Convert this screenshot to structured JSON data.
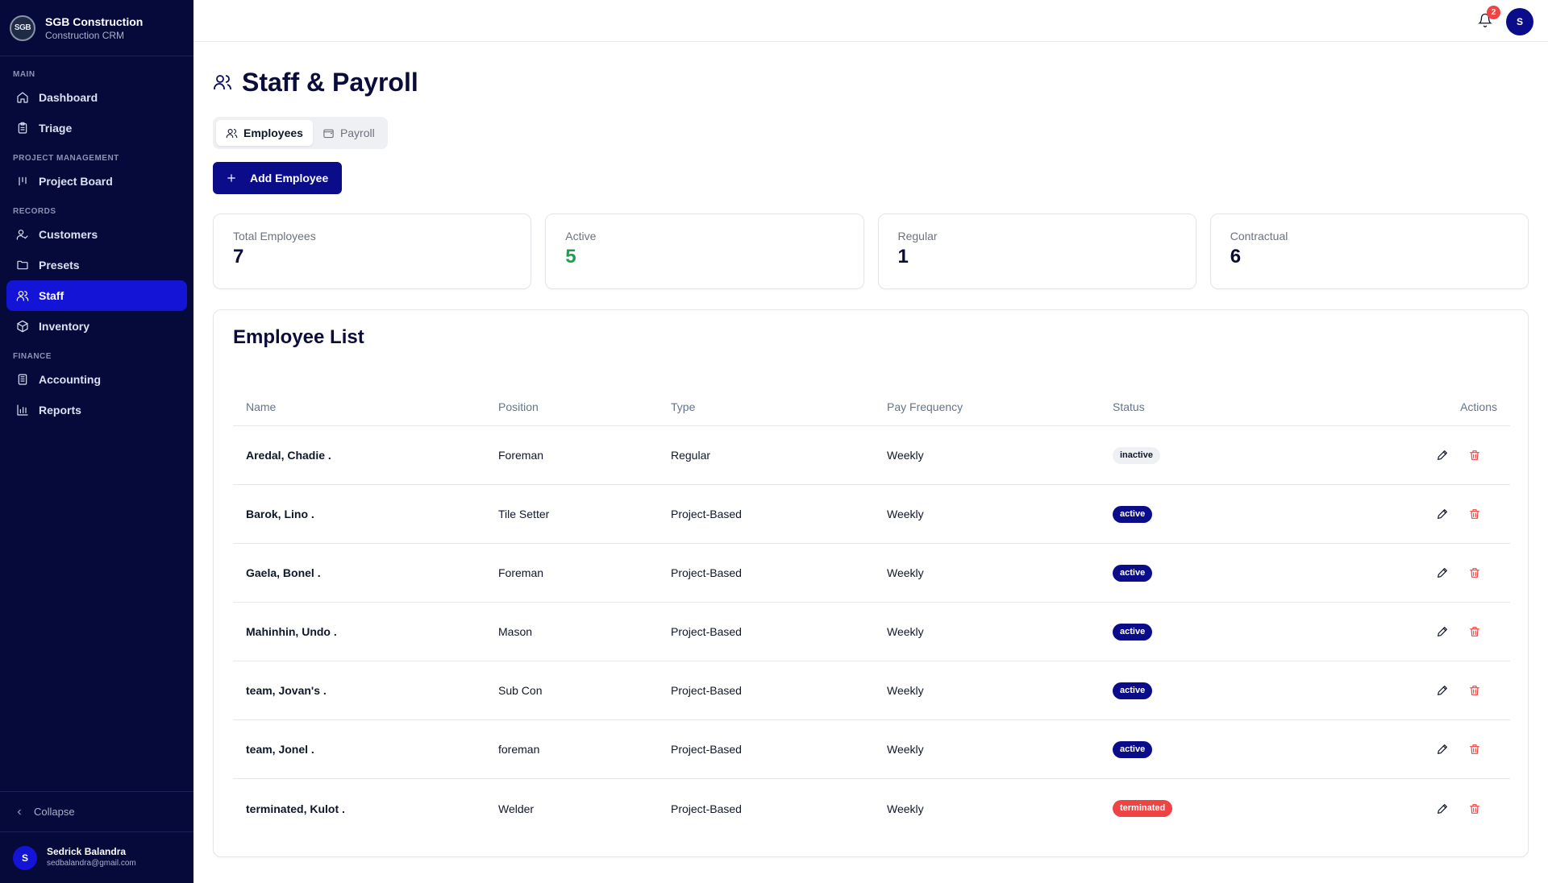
{
  "brand": {
    "logo_text": "SGB",
    "name": "SGB Construction",
    "subtitle": "Construction CRM"
  },
  "sidebar": {
    "sections": [
      {
        "label": "MAIN",
        "items": [
          {
            "label": "Dashboard",
            "icon": "home-icon"
          },
          {
            "label": "Triage",
            "icon": "clipboard-icon"
          }
        ]
      },
      {
        "label": "PROJECT MANAGEMENT",
        "items": [
          {
            "label": "Project Board",
            "icon": "kanban-icon"
          }
        ]
      },
      {
        "label": "RECORDS",
        "items": [
          {
            "label": "Customers",
            "icon": "user-check-icon"
          },
          {
            "label": "Presets",
            "icon": "folder-icon"
          },
          {
            "label": "Staff",
            "icon": "users-icon",
            "active": true
          },
          {
            "label": "Inventory",
            "icon": "package-icon"
          }
        ]
      },
      {
        "label": "FINANCE",
        "items": [
          {
            "label": "Accounting",
            "icon": "ledger-icon"
          },
          {
            "label": "Reports",
            "icon": "bar-chart-icon"
          }
        ]
      }
    ],
    "collapse_label": "Collapse",
    "user": {
      "initial": "S",
      "name": "Sedrick Balandra",
      "email": "sedbalandra@gmail.com"
    }
  },
  "topbar": {
    "notification_count": "2",
    "avatar_initial": "S"
  },
  "page": {
    "title": "Staff & Payroll",
    "tabs": [
      {
        "label": "Employees",
        "active": true
      },
      {
        "label": "Payroll",
        "active": false
      }
    ],
    "add_button_label": "Add Employee"
  },
  "stats": [
    {
      "label": "Total Employees",
      "value": "7"
    },
    {
      "label": "Active",
      "value": "5",
      "color": "#16a34a"
    },
    {
      "label": "Regular",
      "value": "1"
    },
    {
      "label": "Contractual",
      "value": "6"
    }
  ],
  "employee_list": {
    "title": "Employee List",
    "columns": [
      "Name",
      "Position",
      "Type",
      "Pay Frequency",
      "Status",
      "Actions"
    ],
    "rows": [
      {
        "name": "Aredal, Chadie .",
        "position": "Foreman",
        "type": "Regular",
        "pay_frequency": "Weekly",
        "status": "inactive"
      },
      {
        "name": "Barok, Lino .",
        "position": "Tile Setter",
        "type": "Project-Based",
        "pay_frequency": "Weekly",
        "status": "active"
      },
      {
        "name": "Gaela, Bonel .",
        "position": "Foreman",
        "type": "Project-Based",
        "pay_frequency": "Weekly",
        "status": "active"
      },
      {
        "name": "Mahinhin, Undo .",
        "position": "Mason",
        "type": "Project-Based",
        "pay_frequency": "Weekly",
        "status": "active"
      },
      {
        "name": "team, Jovan's .",
        "position": "Sub Con",
        "type": "Project-Based",
        "pay_frequency": "Weekly",
        "status": "active"
      },
      {
        "name": "team, Jonel .",
        "position": "foreman",
        "type": "Project-Based",
        "pay_frequency": "Weekly",
        "status": "active"
      },
      {
        "name": "terminated, Kulot .",
        "position": "Welder",
        "type": "Project-Based",
        "pay_frequency": "Weekly",
        "status": "terminated"
      }
    ]
  },
  "colors": {
    "sidebar_bg": "#060a3a",
    "active_nav": "#1314d6",
    "primary": "#0a0c8a",
    "danger": "#ef4444",
    "success": "#16a34a"
  }
}
